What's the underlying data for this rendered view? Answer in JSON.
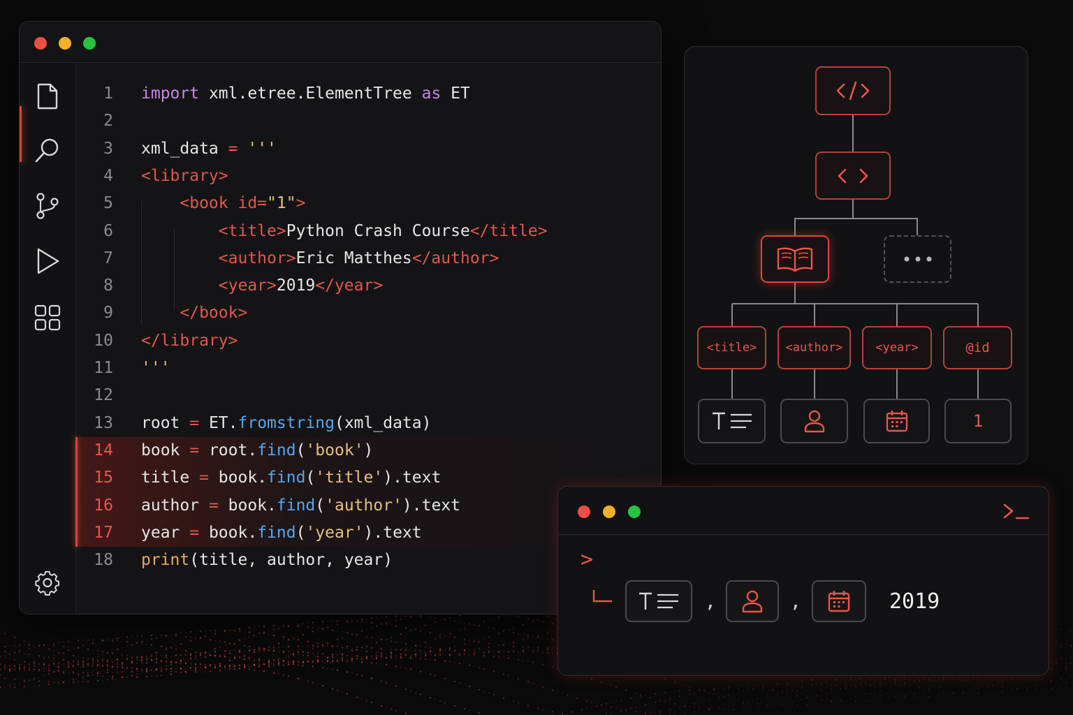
{
  "editor": {
    "window_controls": [
      "close",
      "minimize",
      "maximize"
    ],
    "activity_bar": [
      "files-icon",
      "search-icon",
      "source-control-icon",
      "run-icon",
      "extensions-icon",
      "settings-icon"
    ],
    "lines": [
      {
        "n": "1",
        "tokens": [
          [
            "kw",
            "import"
          ],
          [
            "",
            " xml.etree.ElementTree "
          ],
          [
            "kw",
            "as"
          ],
          [
            "",
            " ET"
          ]
        ]
      },
      {
        "n": "2",
        "tokens": []
      },
      {
        "n": "3",
        "tokens": [
          [
            "",
            "xml_data "
          ],
          [
            "op",
            "="
          ],
          [
            "",
            " "
          ],
          [
            "str",
            "'''"
          ]
        ]
      },
      {
        "n": "4",
        "tokens": [
          [
            "tag",
            "<library>"
          ]
        ]
      },
      {
        "n": "5",
        "tokens": [
          [
            "",
            "    "
          ],
          [
            "tag",
            "<book "
          ],
          [
            "tag",
            "id="
          ],
          [
            "str",
            "\"1\""
          ],
          [
            "tag",
            ">"
          ]
        ]
      },
      {
        "n": "6",
        "tokens": [
          [
            "",
            "        "
          ],
          [
            "tag",
            "<title>"
          ],
          [
            "",
            "Python Crash Course"
          ],
          [
            "tag",
            "</title>"
          ]
        ]
      },
      {
        "n": "7",
        "tokens": [
          [
            "",
            "        "
          ],
          [
            "tag",
            "<author>"
          ],
          [
            "",
            "Eric Matthes"
          ],
          [
            "tag",
            "</author>"
          ]
        ]
      },
      {
        "n": "8",
        "tokens": [
          [
            "",
            "        "
          ],
          [
            "tag",
            "<year>"
          ],
          [
            "",
            "2019"
          ],
          [
            "tag",
            "</year>"
          ]
        ]
      },
      {
        "n": "9",
        "tokens": [
          [
            "",
            "    "
          ],
          [
            "tag",
            "</book>"
          ]
        ]
      },
      {
        "n": "10",
        "tokens": [
          [
            "tag",
            "</library>"
          ]
        ]
      },
      {
        "n": "11",
        "tokens": [
          [
            "str",
            "'''"
          ]
        ]
      },
      {
        "n": "12",
        "tokens": []
      },
      {
        "n": "13",
        "tokens": [
          [
            "",
            "root "
          ],
          [
            "op",
            "="
          ],
          [
            "",
            " ET."
          ],
          [
            "fn",
            "fromstring"
          ],
          [
            "",
            "(xml_data)"
          ]
        ]
      },
      {
        "n": "14",
        "tokens": [
          [
            "",
            "book "
          ],
          [
            "op",
            "="
          ],
          [
            "",
            " root."
          ],
          [
            "fn",
            "find"
          ],
          [
            "",
            "("
          ],
          [
            "str",
            "'book'"
          ],
          [
            "",
            ")"
          ]
        ]
      },
      {
        "n": "15",
        "tokens": [
          [
            "",
            "title "
          ],
          [
            "op",
            "="
          ],
          [
            "",
            " book."
          ],
          [
            "fn",
            "find"
          ],
          [
            "",
            "("
          ],
          [
            "str",
            "'title'"
          ],
          [
            "",
            ").text"
          ]
        ]
      },
      {
        "n": "16",
        "tokens": [
          [
            "",
            "author "
          ],
          [
            "op",
            "="
          ],
          [
            "",
            " book."
          ],
          [
            "fn",
            "find"
          ],
          [
            "",
            "("
          ],
          [
            "str",
            "'author'"
          ],
          [
            "",
            ").text"
          ]
        ]
      },
      {
        "n": "17",
        "tokens": [
          [
            "",
            "year "
          ],
          [
            "op",
            "="
          ],
          [
            "",
            " book."
          ],
          [
            "fn",
            "find"
          ],
          [
            "",
            "("
          ],
          [
            "str",
            "'year'"
          ],
          [
            "",
            ").text"
          ]
        ]
      },
      {
        "n": "18",
        "tokens": [
          [
            "pr",
            "print"
          ],
          [
            "",
            "(title, author, year)"
          ]
        ]
      }
    ],
    "highlighted_lines": [
      "14",
      "15",
      "16",
      "17"
    ]
  },
  "tree": {
    "root_icon": "code-tag-icon",
    "element_icon": "angle-brackets-icon",
    "book_icon": "open-book-icon",
    "more_icon": "ellipsis-icon",
    "children": [
      {
        "label": "<title>",
        "value_icon": "text-icon"
      },
      {
        "label": "<author>",
        "value_icon": "user-icon"
      },
      {
        "label": "<year>",
        "value_icon": "calendar-icon"
      },
      {
        "label": "@id",
        "value": "1"
      }
    ]
  },
  "terminal": {
    "window_controls": [
      "close",
      "minimize",
      "maximize"
    ],
    "prompt_icon": "terminal-prompt-icon",
    "chevron": ">",
    "separator": ",",
    "output_icons": [
      "text-icon",
      "user-icon",
      "calendar-icon"
    ],
    "output_value": "2019"
  },
  "colors": {
    "accent": "#e0443a",
    "close": "#ee4f45",
    "minimize": "#f5b026",
    "maximize": "#27c23f"
  }
}
